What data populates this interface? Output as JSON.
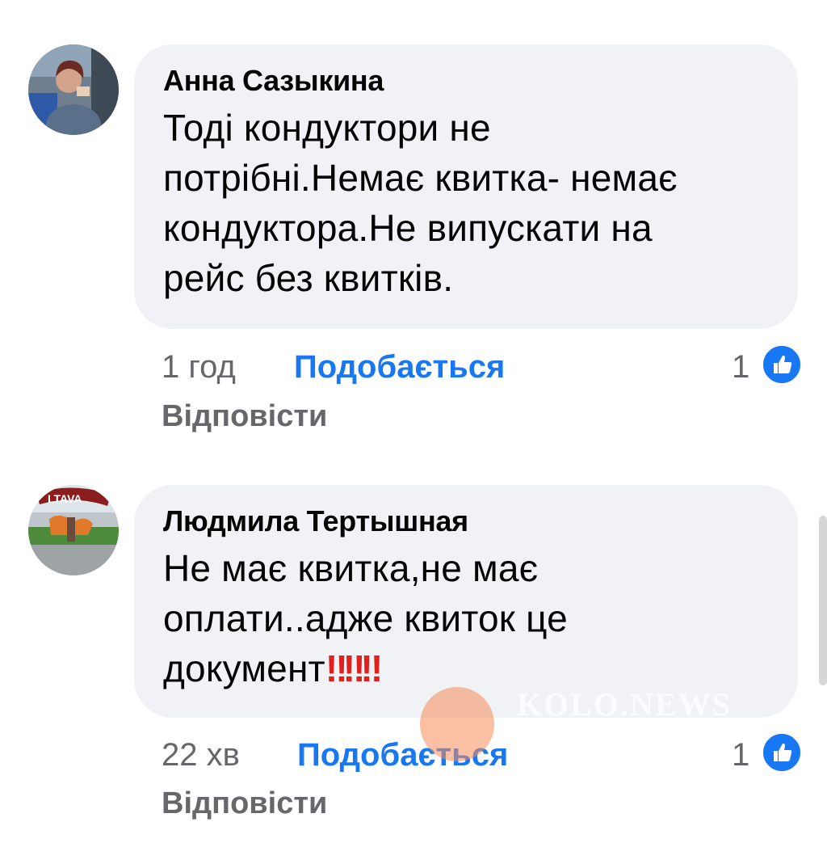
{
  "comments": [
    {
      "author": "Анна Сазыкина",
      "lines": [
        "Тоді кондуктори не",
        "потрібні.Немає квитка- немає",
        "кондуктора.Не випускати на",
        "рейс без квитків."
      ],
      "time": "1 год",
      "like_label": "Подобається",
      "reply_label": "Відповісти",
      "like_count": "1",
      "avatar_icon": "avatar-photo-woman"
    },
    {
      "author": "Людмила Тертышная",
      "lines": [
        "Не має квитка,не має",
        "оплати..адже квиток це",
        "документ"
      ],
      "emoji": "‼‼‼",
      "time": "22 хв",
      "like_label": "Подобається",
      "reply_label": "Відповісти",
      "like_count": "1",
      "avatar_icon": "avatar-photo-poltava",
      "avatar_sign_text": "LTAVA",
      "watermark": "KOLO.NEWS"
    }
  ],
  "colors": {
    "bubble": "#f0f2f5",
    "link": "#1877f2",
    "meta": "#65676b",
    "text": "#050505",
    "emoji": "#e0201c"
  },
  "icons": [
    "like-thumb-icon"
  ]
}
